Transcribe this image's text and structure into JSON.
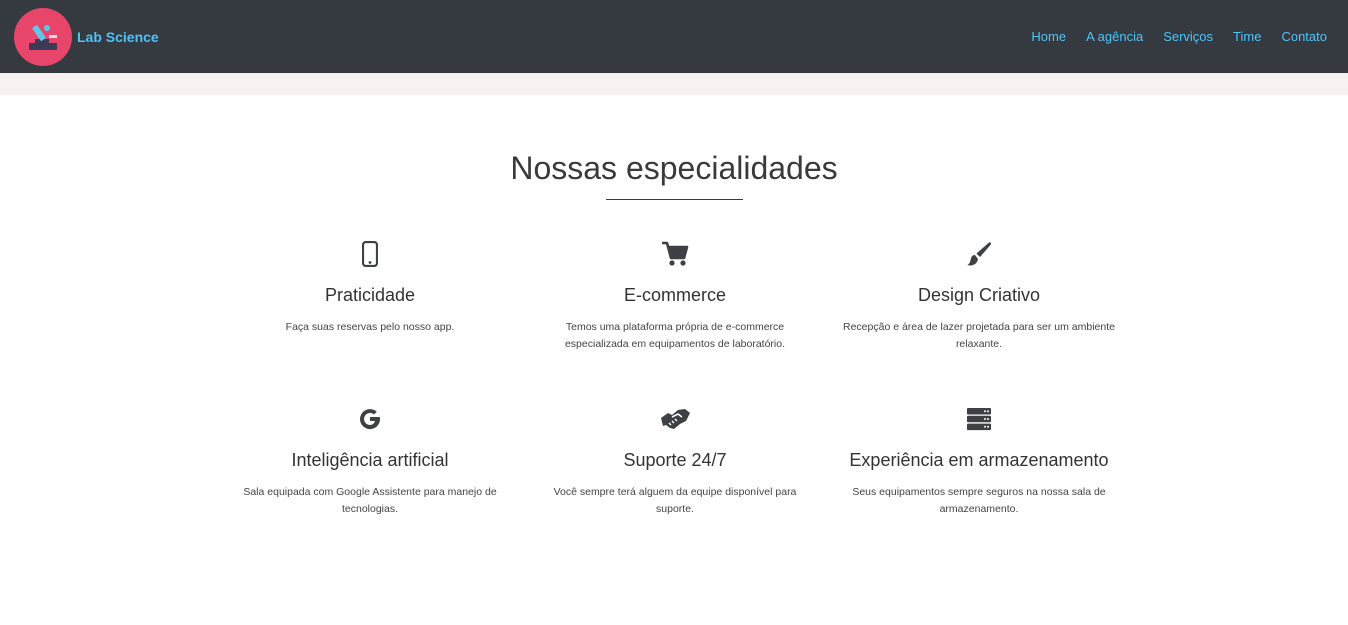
{
  "navbar": {
    "brand": "Lab Science",
    "links": [
      "Home",
      "A agência",
      "Serviços",
      "Time",
      "Contato"
    ]
  },
  "section": {
    "title": "Nossas especialidades"
  },
  "features": [
    {
      "icon": "mobile-phone-icon",
      "title": "Praticidade",
      "description": "Faça suas reservas pelo nosso app."
    },
    {
      "icon": "shopping-cart-icon",
      "title": "E-commerce",
      "description": "Temos uma plataforma própria de e-commerce especializada em equipamentos de laboratório."
    },
    {
      "icon": "paint-brush-icon",
      "title": "Design Criativo",
      "description": "Recepção e área de lazer projetada para ser um ambiente relaxante."
    },
    {
      "icon": "google-icon",
      "title": "Inteligência artificial",
      "description": "Sala equipada com Google Assistente para manejo de tecnologias."
    },
    {
      "icon": "handshake-icon",
      "title": "Suporte 24/7",
      "description": "Você sempre terá alguem da equipe disponível para suporte."
    },
    {
      "icon": "server-icon",
      "title": "Experiência em armazenamento",
      "description": "Seus equipamentos sempre seguros na nossa sala de armazenamento."
    }
  ],
  "colors": {
    "navbar_bg": "#343a40",
    "nav_link": "#4fc3f7",
    "logo_bg": "#e8456b",
    "band_bg": "#f8f1f1",
    "icon": "#3d4045"
  }
}
